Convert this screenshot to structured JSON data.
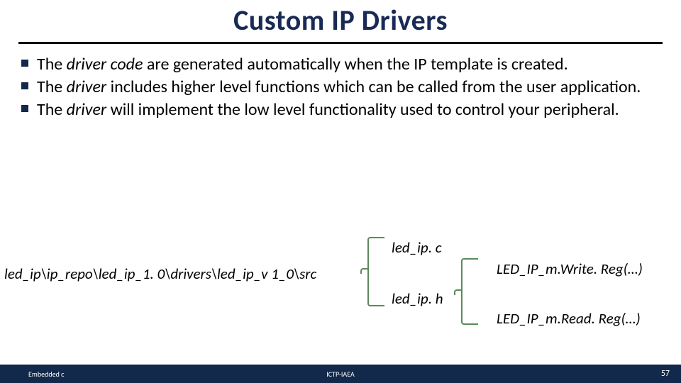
{
  "title": "Custom IP Drivers",
  "bullets": [
    {
      "kw": "driver code",
      "rest": "are generated automatically when the IP template is created."
    },
    {
      "kw": "driver",
      "rest": "includes higher level functions which can be called from the user application."
    },
    {
      "kw": "driver",
      "rest": "will implement the low level functionality used to control your peripheral."
    }
  ],
  "diagram": {
    "src_path": "led_ip\\ip_repo\\led_ip_1. 0\\drivers\\led_ip_v 1_0\\src",
    "file_c": "led_ip. c",
    "file_h": "led_ip. h",
    "fn_write": "LED_IP_m.Write. Reg(…)",
    "fn_read": "LED_IP_m.Read. Reg(…)"
  },
  "footer": {
    "left": "Embedded c",
    "center": "ICTP-IAEA",
    "page": "57"
  }
}
